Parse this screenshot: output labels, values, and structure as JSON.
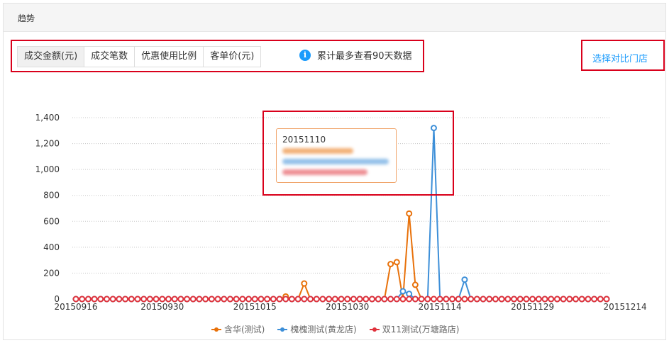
{
  "panel": {
    "title": "趋势"
  },
  "tabs": [
    {
      "label": "成交金额(元)",
      "active": true
    },
    {
      "label": "成交笔数",
      "active": false
    },
    {
      "label": "优惠使用比例",
      "active": false
    },
    {
      "label": "客单价(元)",
      "active": false
    }
  ],
  "info": {
    "icon": "info-icon",
    "text": "累计最多查看90天数据"
  },
  "compare_link": "选择对比门店",
  "tooltip": {
    "date": "20151110"
  },
  "chart_data": {
    "type": "line",
    "start_date": "20150916",
    "x_tick_labels": [
      "20150916",
      "20150930",
      "20151015",
      "20151030",
      "20151114",
      "20151129",
      "20151214"
    ],
    "ylim": [
      0,
      1400
    ],
    "yticks": [
      0,
      200,
      400,
      600,
      800,
      1000,
      1200,
      1400
    ],
    "ytick_labels": [
      "0",
      "200",
      "400",
      "600",
      "800",
      "1,000",
      "1,200",
      "1,400"
    ],
    "grid": true,
    "legend_position": "bottom",
    "series": [
      {
        "name": "含华(测试)",
        "color": "#e8710a",
        "values": [
          0,
          0,
          0,
          0,
          0,
          0,
          0,
          0,
          0,
          0,
          0,
          0,
          0,
          0,
          0,
          0,
          0,
          0,
          0,
          0,
          0,
          0,
          0,
          0,
          0,
          0,
          0,
          0,
          0,
          0,
          0,
          0,
          0,
          0,
          20,
          0,
          0,
          120,
          0,
          0,
          0,
          0,
          0,
          0,
          0,
          0,
          0,
          0,
          0,
          0,
          0,
          270,
          285,
          0,
          660,
          110,
          0,
          0,
          0,
          0,
          0,
          0,
          0,
          0,
          0,
          0,
          0,
          0,
          0,
          0,
          0,
          0,
          0,
          0,
          0,
          0,
          0,
          0,
          0,
          0,
          0,
          0,
          0,
          0,
          0,
          0,
          0
        ]
      },
      {
        "name": "槐槐测试(黄龙店)",
        "color": "#3d8fd8",
        "values": [
          0,
          0,
          0,
          0,
          0,
          0,
          0,
          0,
          0,
          0,
          0,
          0,
          0,
          0,
          0,
          0,
          0,
          0,
          0,
          0,
          0,
          0,
          0,
          0,
          0,
          0,
          0,
          0,
          0,
          0,
          0,
          0,
          0,
          0,
          0,
          0,
          0,
          0,
          0,
          0,
          0,
          0,
          0,
          0,
          0,
          0,
          0,
          0,
          0,
          0,
          0,
          0,
          0,
          60,
          40,
          0,
          0,
          0,
          1320,
          0,
          0,
          0,
          0,
          150,
          0,
          0,
          0,
          0,
          0,
          0,
          0,
          0,
          0,
          0,
          0,
          0,
          0,
          0,
          0,
          0,
          0,
          0,
          0,
          0,
          0,
          0,
          0
        ]
      },
      {
        "name": "双11测试(万塘路店)",
        "color": "#e0323c",
        "values": [
          0,
          0,
          0,
          0,
          0,
          0,
          0,
          0,
          0,
          0,
          0,
          0,
          0,
          0,
          0,
          0,
          0,
          0,
          0,
          0,
          0,
          0,
          0,
          0,
          0,
          0,
          0,
          0,
          0,
          0,
          0,
          0,
          0,
          0,
          0,
          0,
          0,
          0,
          0,
          0,
          0,
          0,
          0,
          0,
          0,
          0,
          0,
          0,
          0,
          0,
          0,
          0,
          0,
          0,
          0,
          0,
          0,
          0,
          0,
          0,
          0,
          0,
          0,
          0,
          0,
          0,
          0,
          0,
          0,
          0,
          0,
          0,
          0,
          0,
          0,
          0,
          0,
          0,
          0,
          0,
          0,
          0,
          0,
          0,
          0,
          0,
          0
        ]
      }
    ]
  }
}
